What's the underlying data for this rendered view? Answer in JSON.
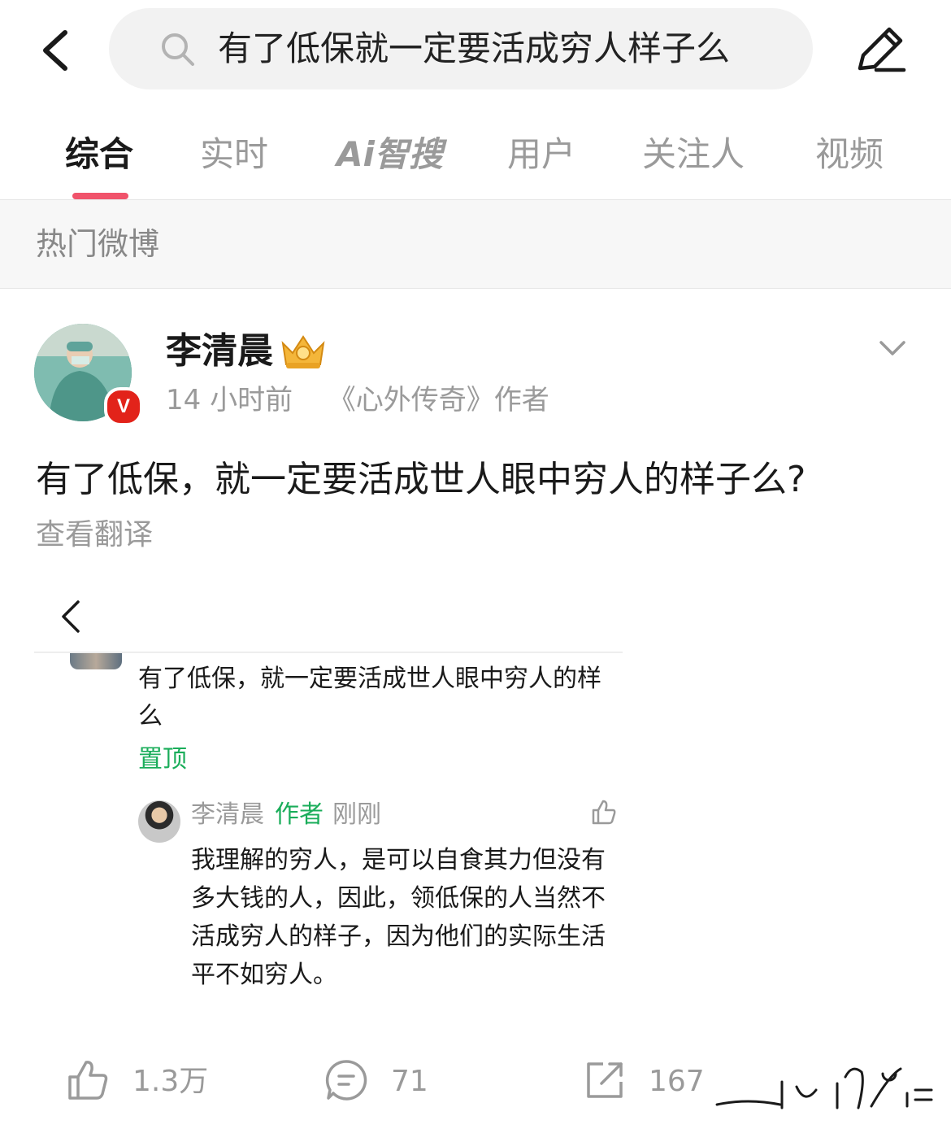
{
  "search": {
    "query": "有了低保就一定要活成穷人样子么"
  },
  "tabs": [
    {
      "label": "综合",
      "active": true
    },
    {
      "label": "实时",
      "active": false
    },
    {
      "label": "Ai智搜",
      "active": false
    },
    {
      "label": "用户",
      "active": false
    },
    {
      "label": "关注人",
      "active": false
    },
    {
      "label": "视频",
      "active": false
    }
  ],
  "section": {
    "title": "热门微博"
  },
  "post": {
    "username": "李清晨",
    "verified_badge": "V",
    "time": "14 小时前",
    "source": "《心外传奇》作者",
    "text": "有了低保，就一定要活成世人眼中穷人的样子么?",
    "translate_label": "查看翻译",
    "embedded": {
      "comment_line1": "有了低保，就一定要活成世人眼中穷人的样",
      "comment_line2": "么",
      "pinned_label": "置顶",
      "reply": {
        "name": "李清晨",
        "author_tag": "作者",
        "time": "刚刚",
        "lines": [
          "我理解的穷人，是可以自食其力但没有",
          "多大钱的人，因此，领低保的人当然不",
          "活成穷人的样子，因为他们的实际生活",
          "平不如穷人。"
        ]
      }
    },
    "actions": {
      "likes": "1.3万",
      "comments": "71",
      "reposts": "167"
    }
  },
  "colors": {
    "accent": "#f0536b",
    "green": "#1aad5a",
    "muted": "#9a9a9a"
  },
  "icons": [
    "back-arrow-icon",
    "search-icon",
    "edit-pencil-icon",
    "crown-icon",
    "chevron-down-icon",
    "thumb-up-icon",
    "comment-icon",
    "repost-icon"
  ]
}
